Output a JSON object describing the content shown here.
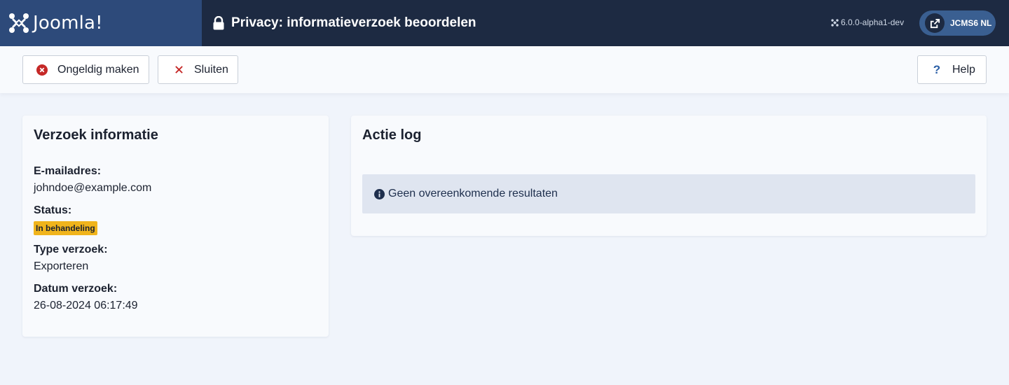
{
  "header": {
    "logo_text": "Joomla!",
    "title": "Privacy: informatieverzoek beoordelen",
    "version": "6.0.0-alpha1-dev",
    "site_label": "JCMS6 NL"
  },
  "toolbar": {
    "invalidate_label": "Ongeldig maken",
    "close_label": "Sluiten",
    "help_label": "Help"
  },
  "request_info": {
    "title": "Verzoek informatie",
    "email_label": "E-mailadres:",
    "email_value": "johndoe@example.com",
    "status_label": "Status:",
    "status_value": "In behandeling",
    "type_label": "Type verzoek:",
    "type_value": "Exporteren",
    "date_label": "Datum verzoek:",
    "date_value": "26-08-2024 06:17:49"
  },
  "action_log": {
    "title": "Actie log",
    "empty_message": "Geen overeenkomende resultaten"
  },
  "colors": {
    "header_bg": "#1d2a42",
    "logo_bg": "#2d4a7a",
    "status_badge": "#f0b41c",
    "danger": "#c52827",
    "alert_bg": "#dfe5f0"
  }
}
